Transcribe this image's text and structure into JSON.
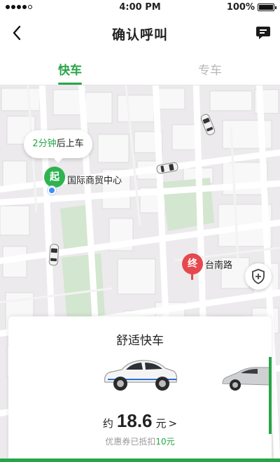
{
  "status_bar": {
    "time": "4:00 PM",
    "battery": "100%"
  },
  "header": {
    "title": "确认呼叫",
    "back_icon": "chevron-left-icon",
    "message_icon": "message-icon"
  },
  "tabs": [
    {
      "label": "快车",
      "active": true
    },
    {
      "label": "专车",
      "active": false
    }
  ],
  "map": {
    "bubble": {
      "minutes": "2分钟",
      "suffix": "后上车"
    },
    "start": {
      "badge": "起",
      "place": "国际商贸中心"
    },
    "end": {
      "badge": "终",
      "place": "台南路"
    }
  },
  "card": {
    "title": "舒适快车",
    "price_prefix": "约",
    "price": "18.6",
    "price_unit": "元",
    "coupon_prefix": "优惠券已抵扣",
    "coupon_amount": "10元"
  },
  "colors": {
    "accent": "#27a546",
    "end_pin": "#e5484d",
    "location_dot": "#3d8ef0"
  }
}
